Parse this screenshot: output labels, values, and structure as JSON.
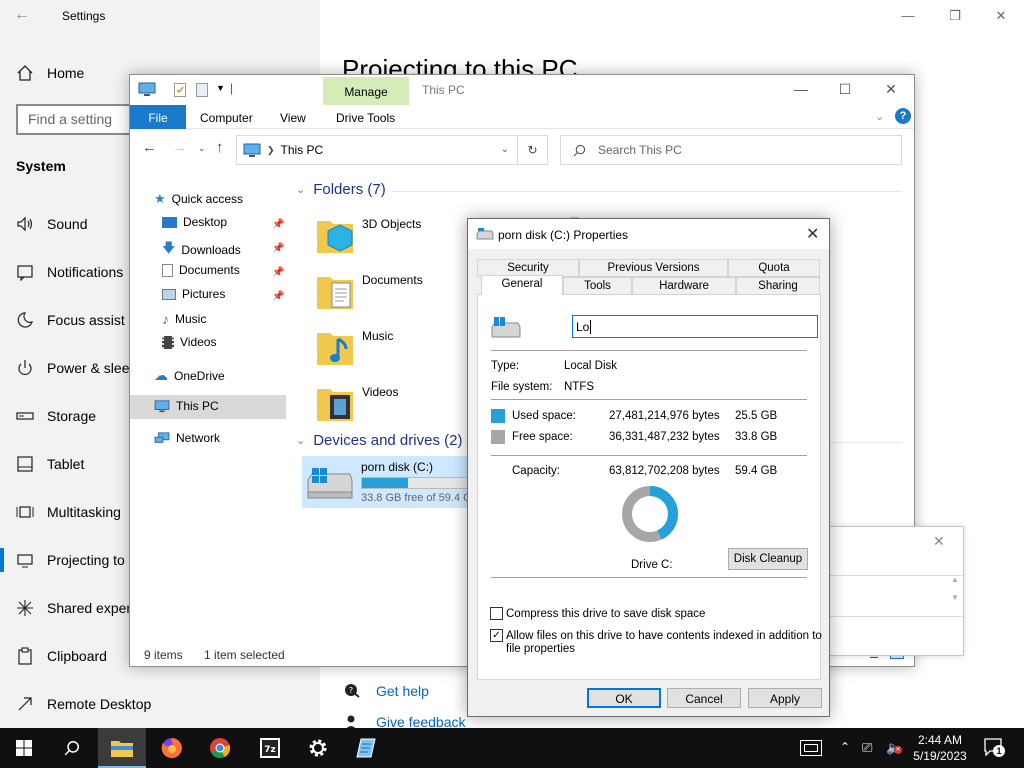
{
  "settings": {
    "title": "Settings",
    "home": "Home",
    "search_placeholder": "Find a setting",
    "section": "System",
    "items": [
      "Sound",
      "Notifications",
      "Focus assist",
      "Power & sleep",
      "Storage",
      "Tablet",
      "Multitasking",
      "Projecting to",
      "Shared experi",
      "Clipboard",
      "Remote Desktop"
    ],
    "heading": "Projecting to this PC",
    "links": {
      "help": "Get help",
      "feedback": "Give feedback"
    }
  },
  "explorer": {
    "manage_tab": "Manage",
    "title": "This PC",
    "tabs": {
      "file": "File",
      "computer": "Computer",
      "view": "View",
      "drive_tools": "Drive Tools"
    },
    "address": "This PC",
    "search_placeholder": "Search This PC",
    "nav": {
      "quick_access": "Quick access",
      "pinned": [
        "Desktop",
        "Downloads",
        "Documents",
        "Pictures"
      ],
      "other": [
        "Music",
        "Videos"
      ],
      "onedrive": "OneDrive",
      "this_pc": "This PC",
      "network": "Network"
    },
    "folders_group": "Folders (7)",
    "folders": [
      "3D Objects",
      "Documents",
      "Music",
      "Videos"
    ],
    "devices_group": "Devices and drives (2)",
    "drive": {
      "name": "porn disk (C:)",
      "free_text": "33.8 GB free of 59.4 G",
      "used_fraction": 0.43
    },
    "status": {
      "items": "9 items",
      "selected": "1 item selected"
    }
  },
  "dialog": {
    "title": "porn disk (C:) Properties",
    "tabs_row1": [
      "Security",
      "Previous Versions",
      "Quota"
    ],
    "tabs_row2": [
      "General",
      "Tools",
      "Hardware",
      "Sharing"
    ],
    "name_value": "Lo",
    "type_label": "Type:",
    "type_value": "Local Disk",
    "fs_label": "File system:",
    "fs_value": "NTFS",
    "used_label": "Used space:",
    "used_bytes": "27,481,214,976 bytes",
    "used_gb": "25.5 GB",
    "free_label": "Free space:",
    "free_bytes": "36,331,487,232 bytes",
    "free_gb": "33.8 GB",
    "capacity_label": "Capacity:",
    "capacity_bytes": "63,812,702,208 bytes",
    "capacity_gb": "59.4 GB",
    "drive_label": "Drive C:",
    "cleanup": "Disk Cleanup",
    "compress": "Compress this drive to save disk space",
    "index_line1": "Allow files on this drive to have contents indexed in addition to",
    "index_line2": "file properties",
    "compress_checked": false,
    "index_checked": true,
    "used_fraction": 0.43,
    "colors": {
      "used": "#26a0da",
      "free": "#a6a6a6"
    },
    "buttons": {
      "ok": "OK",
      "cancel": "Cancel",
      "apply": "Apply"
    }
  },
  "taskbar": {
    "time": "2:44 AM",
    "date": "5/19/2023",
    "notification_count": "1",
    "apps": [
      "start-icon",
      "search-icon",
      "file-explorer-icon",
      "firefox-icon",
      "chrome-icon",
      "7zip-icon",
      "settings-icon",
      "notepad-icon"
    ]
  }
}
